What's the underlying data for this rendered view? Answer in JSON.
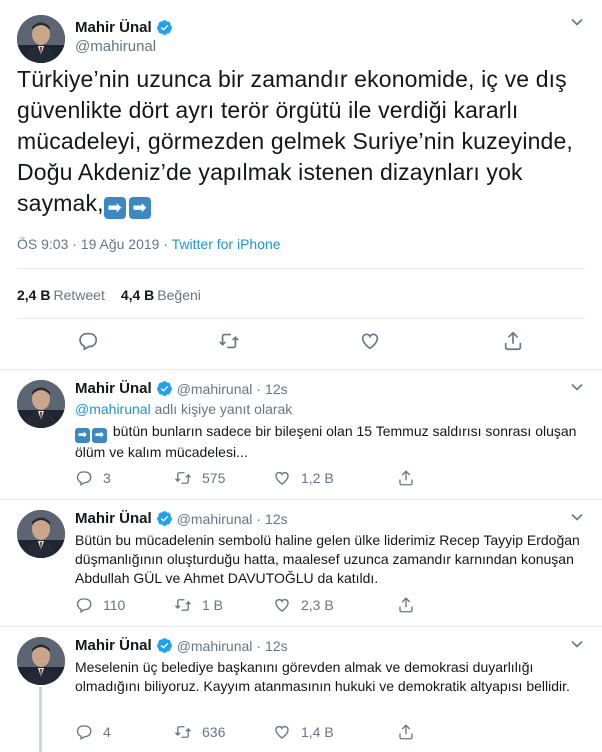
{
  "main_tweet": {
    "author_name": "Mahir Ünal",
    "author_handle": "@mahirunal",
    "text_before_emoji": "Türkiye’nin uzunca bir zamandır ekonomide, iç ve dış güvenlikte dört ayrı terör örgütü ile verdiği kararlı mücadeleyi, görmezden gelmek Suriye’nin kuzeyinde, Doğu Akdeniz’de yapılmak istenen dizaynları yok saymak,",
    "emoji_glyph": "➡",
    "time": "ÖS 9:03 · 19 Ağu 2019 ·",
    "source": "Twitter for iPhone",
    "retweet_count": "2,4 B",
    "retweet_label": "Retweet",
    "like_count": "4,4 B",
    "like_label": "Beğeni"
  },
  "replies": [
    {
      "author_name": "Mahir Ünal",
      "author_handle": "@mahirunal",
      "time_sep": "·",
      "time": "12s",
      "reply_mention": "@mahirunal",
      "reply_suffix": "adlı kişiye yanıt olarak",
      "text": "bütün bunların sadece bir bileşeni olan 15 Temmuz saldırısı sonrası oluşan ölüm ve kalım mücadelesi...",
      "replies_count": "3",
      "retweets_count": "575",
      "likes_count": "1,2 B"
    },
    {
      "author_name": "Mahir Ünal",
      "author_handle": "@mahirunal",
      "time_sep": "·",
      "time": "12s",
      "text": "Bütün bu mücadelenin sembolü haline gelen ülke liderimiz Recep Tayyip Erdoğan düşmanlığının oluşturduğu  hatta,  maalesef uzunca zamandır karnından konuşan Abdullah GÜL ve Ahmet DAVUTOĞLU da katıldı.",
      "replies_count": "110",
      "retweets_count": "1 B",
      "likes_count": "2,3 B"
    },
    {
      "author_name": "Mahir Ünal",
      "author_handle": "@mahirunal",
      "time_sep": "·",
      "time": "12s",
      "text": "Meselenin üç belediye başkanını görevden almak ve demokrasi duyarlılığı olmadığını biliyoruz. Kayyım atanmasının hukuki ve demokratik altyapısı bellidir.",
      "replies_count": "4",
      "retweets_count": "636",
      "likes_count": "1,4 B"
    }
  ],
  "colors": {
    "accent": "#1b95e0",
    "secondary_text": "#657786",
    "primary_text": "#14171a",
    "divider": "#e6ecf0",
    "emoji_blue": "#3b88c3"
  },
  "icons": [
    "chevron-down-icon",
    "verified-badge-icon",
    "reply-icon",
    "retweet-icon",
    "like-icon",
    "share-icon",
    "right-arrow-emoji"
  ]
}
